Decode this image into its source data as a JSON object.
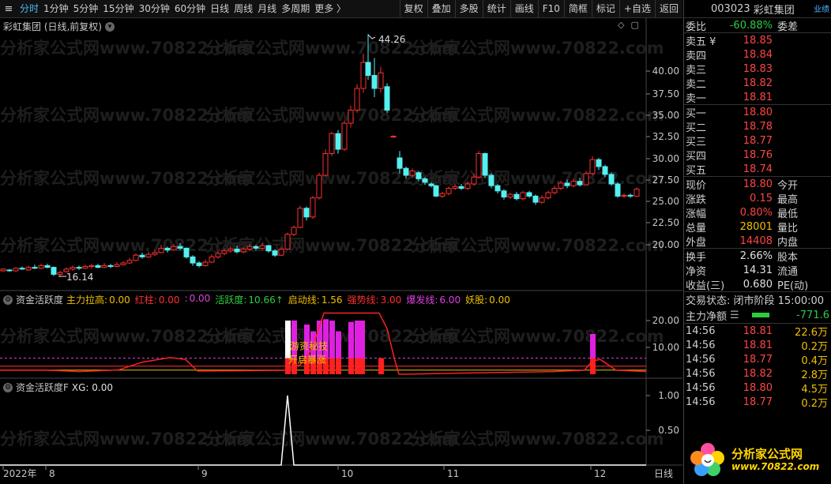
{
  "toolbar": {
    "menu_icon": "≡",
    "periods": [
      "分时",
      "1分钟",
      "5分钟",
      "15分钟",
      "30分钟",
      "60分钟",
      "日线",
      "周线",
      "月线",
      "多周期",
      "更多 〉"
    ],
    "active_period": 0,
    "tools": [
      "复权",
      "叠加",
      "多股",
      "统计",
      "画线",
      "F10",
      "简框",
      "标记",
      "+自选",
      "返回"
    ]
  },
  "main_chart": {
    "title": "彩虹集团 (日线,前复权)",
    "high_label": "44.26",
    "low_label": "16.14",
    "y_ticks": [
      "40.00",
      "37.50",
      "35.00",
      "32.50",
      "30.00",
      "27.50",
      "25.00",
      "22.50",
      "20.00"
    ],
    "watermark": "分析家公式网www.70822.com"
  },
  "indicator1": {
    "name": "资金活跃度",
    "items": [
      {
        "label": "主力拉高:",
        "value": "0.00",
        "color": "#f0c000"
      },
      {
        "label": "红柱:",
        "value": "0.00",
        "color": "#ff3030"
      },
      {
        "label": ":",
        "value": "0.00",
        "color": "#e040e0"
      },
      {
        "label": "活跃度:",
        "value": "10.66↑",
        "color": "#2ecc40"
      },
      {
        "label": "启动线:",
        "value": "1.56",
        "color": "#f0c000"
      },
      {
        "label": "强势线:",
        "value": "3.00",
        "color": "#ff3030"
      },
      {
        "label": "爆发线:",
        "value": "6.00",
        "color": "#e040e0"
      },
      {
        "label": "妖股:",
        "value": "0.00",
        "color": "#f0c000"
      }
    ],
    "y_ticks": [
      "20.00",
      "10.00"
    ],
    "annotation1": "游资秘技",
    "annotation2": "开启暴涨"
  },
  "indicator2": {
    "name": "资金活跃度F",
    "item": "XG: 0.00",
    "y_ticks": [
      "1.00",
      "0.50"
    ]
  },
  "x_axis": {
    "labels": [
      "2022年",
      "8",
      "9",
      "10",
      "11",
      "12",
      "日线"
    ]
  },
  "quote": {
    "code": "003023",
    "name": "彩虹集团",
    "perf_link": "业绩",
    "weibi_label": "委比",
    "weibi": "-60.88%",
    "weicha_label": "委差",
    "asks": [
      {
        "label": "卖五 ¥",
        "price": "18.85"
      },
      {
        "label": "卖四",
        "price": "18.84"
      },
      {
        "label": "卖三",
        "price": "18.83"
      },
      {
        "label": "卖二",
        "price": "18.82"
      },
      {
        "label": "卖一",
        "price": "18.81"
      }
    ],
    "bids": [
      {
        "label": "买一",
        "price": "18.80"
      },
      {
        "label": "买二",
        "price": "18.78"
      },
      {
        "label": "买三",
        "price": "18.77"
      },
      {
        "label": "买四",
        "price": "18.76"
      },
      {
        "label": "买五",
        "price": "18.74"
      }
    ],
    "stats": [
      {
        "l1": "现价",
        "v1": "18.80",
        "c1": "red",
        "l2": "今开"
      },
      {
        "l1": "涨跌",
        "v1": "0.15",
        "c1": "red",
        "l2": "最高"
      },
      {
        "l1": "涨幅",
        "v1": "0.80%",
        "c1": "red",
        "l2": "最低"
      },
      {
        "l1": "总量",
        "v1": "28001",
        "c1": "yellow",
        "l2": "量比"
      },
      {
        "l1": "外盘",
        "v1": "14408",
        "c1": "red",
        "l2": "内盘"
      }
    ],
    "stats2": [
      {
        "l1": "换手",
        "v1": "2.66%",
        "c1": "white",
        "l2": "股本"
      },
      {
        "l1": "净资",
        "v1": "14.31",
        "c1": "white",
        "l2": "流通"
      },
      {
        "l1": "收益(三)",
        "v1": "0.680",
        "c1": "white",
        "l2": "PE(动)"
      }
    ],
    "trade_status": "交易状态: 闭市阶段 15:00:00",
    "net_label": "主力净额",
    "net_value": "-771.6",
    "ticks": [
      {
        "time": "14:56",
        "price": "18.81",
        "vol": "22.6万"
      },
      {
        "time": "14:56",
        "price": "18.81",
        "vol": "0.2万"
      },
      {
        "time": "14:56",
        "price": "18.77",
        "vol": "0.4万"
      },
      {
        "time": "14:56",
        "price": "18.82",
        "vol": "2.8万"
      },
      {
        "time": "14:56",
        "price": "18.80",
        "vol": "4.5万"
      },
      {
        "time": "14:56",
        "price": "18.77",
        "vol": "0.2万"
      }
    ]
  },
  "logo": {
    "title": "分析家公式网",
    "url": "www.70822.com"
  },
  "colors": {
    "up": "#ff3030",
    "down": "#54f0f0",
    "accent": "#4bb8ff"
  }
}
